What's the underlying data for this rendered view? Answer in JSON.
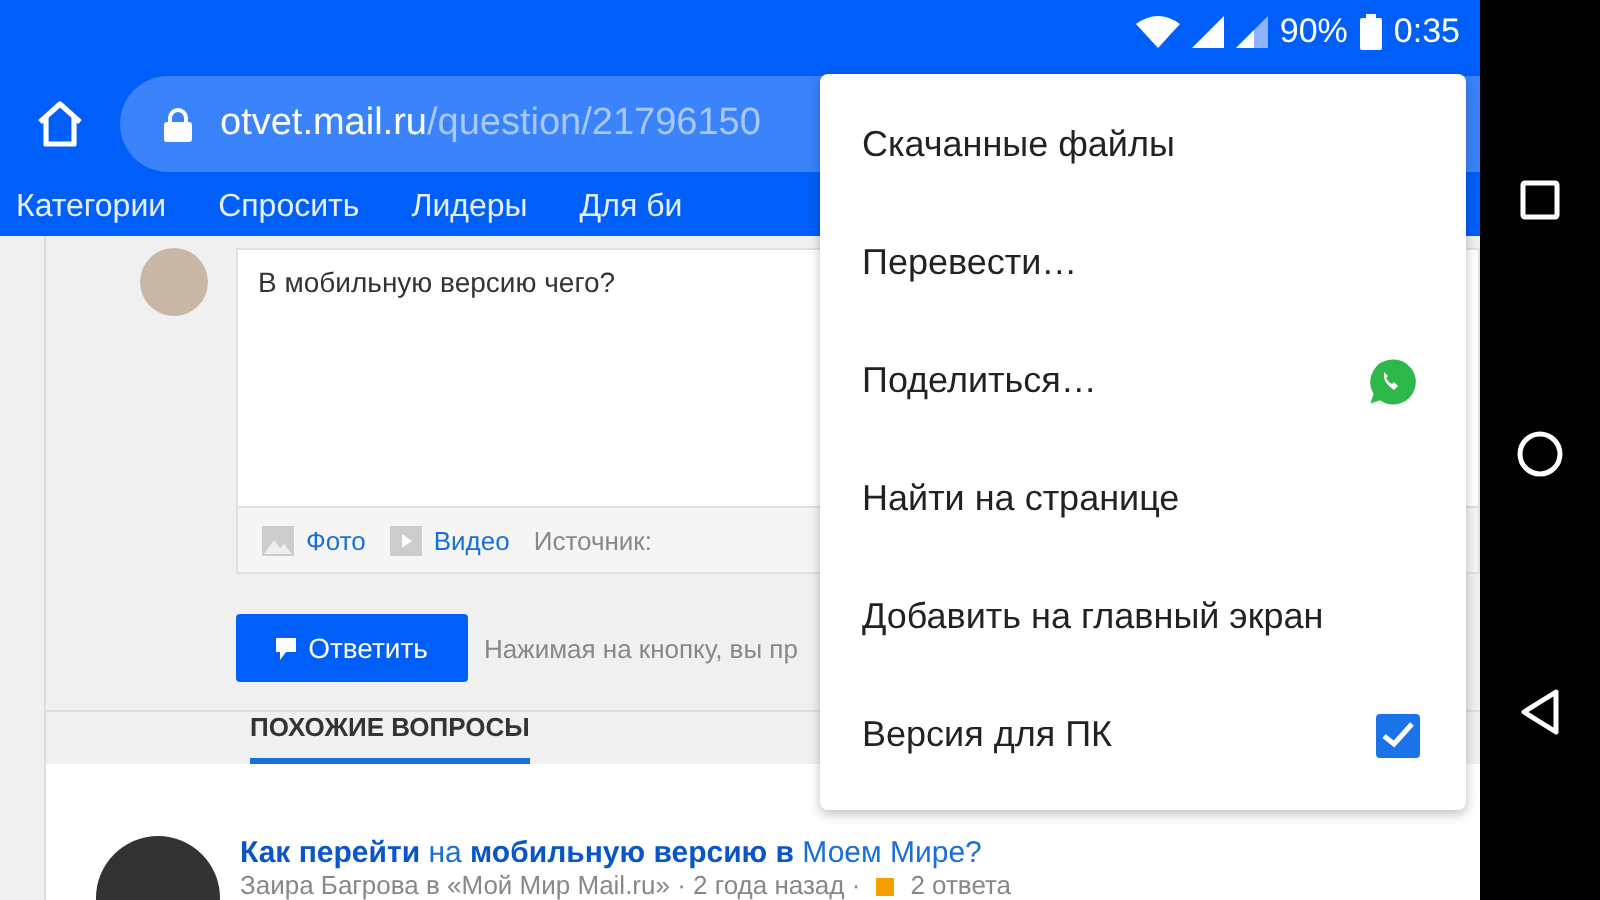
{
  "status_bar": {
    "battery": "90%",
    "time": "0:35"
  },
  "address_bar": {
    "host": "otvet.mail.ru",
    "path": "/question/21796150"
  },
  "site_nav": [
    "Категории",
    "Спросить",
    "Лидеры",
    "Для би"
  ],
  "answer_form": {
    "value": "В мобильную версию чего?",
    "attachments": [
      "Фото",
      "Видео"
    ],
    "source_label": "Источник:",
    "submit": "Ответить",
    "hint": "Нажимая на кнопку, вы пр"
  },
  "similar": {
    "tab": {
      "label": "ПОХОЖИЕ ВОПРОСЫ",
      "selected": true
    },
    "items": [
      {
        "title": "**Как перейти** на **мобильную версию в** Моем Мире?",
        "meta": "Заира Багрова в «Мой Мир Mail.ru» · 2 года назад ·",
        "answers": "2 ответа"
      }
    ]
  },
  "menu": [
    {
      "label": "Скачанные файлы",
      "kind": "plain"
    },
    {
      "label": "Перевести…",
      "kind": "plain"
    },
    {
      "label": "Поделиться…",
      "kind": "share"
    },
    {
      "label": "Найти на странице",
      "kind": "plain"
    },
    {
      "label": "Добавить на главный экран",
      "kind": "plain"
    },
    {
      "label": "Версия для ПК",
      "kind": "checkbox",
      "checked": true
    }
  ]
}
